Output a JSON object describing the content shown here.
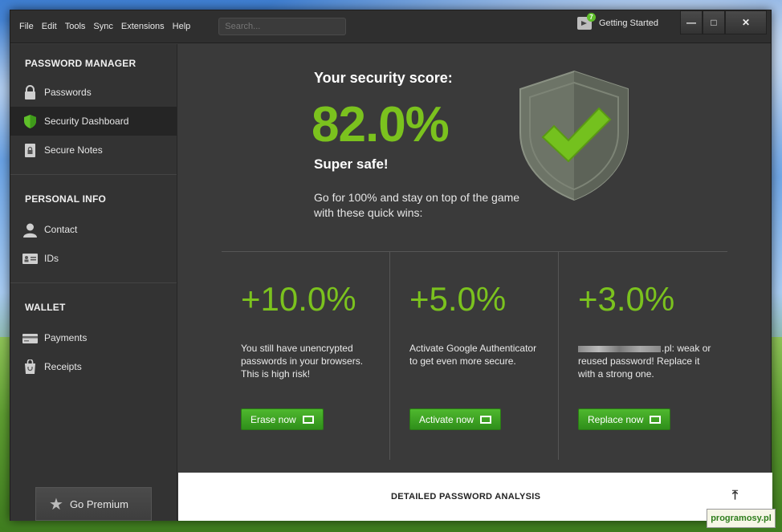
{
  "menu": {
    "items": [
      "File",
      "Edit",
      "Tools",
      "Sync",
      "Extensions",
      "Help"
    ]
  },
  "search": {
    "placeholder": "Search..."
  },
  "header": {
    "getting_started_label": "Getting Started",
    "getting_started_badge": "7"
  },
  "window_controls": {
    "minimize": "—",
    "maximize": "□",
    "close": "✕"
  },
  "sidebar": {
    "sections": [
      {
        "title": "PASSWORD MANAGER",
        "items": [
          {
            "label": "Passwords",
            "icon": "lock-icon"
          },
          {
            "label": "Security Dashboard",
            "icon": "shield-icon",
            "active": true
          },
          {
            "label": "Secure Notes",
            "icon": "note-lock-icon"
          }
        ]
      },
      {
        "title": "PERSONAL INFO",
        "items": [
          {
            "label": "Contact",
            "icon": "person-icon"
          },
          {
            "label": "IDs",
            "icon": "id-card-icon"
          }
        ]
      },
      {
        "title": "WALLET",
        "items": [
          {
            "label": "Payments",
            "icon": "credit-card-icon"
          },
          {
            "label": "Receipts",
            "icon": "receipt-icon"
          }
        ]
      }
    ],
    "premium_label": "Go Premium"
  },
  "score": {
    "title": "Your security score:",
    "value": "82.0%",
    "verdict": "Super safe!",
    "description": "Go for 100% and stay on top of the game with these quick wins:"
  },
  "quick_wins": [
    {
      "percent": "+10.0%",
      "text": "You still have unencrypted passwords in your browsers. This is high risk!",
      "button": "Erase now"
    },
    {
      "percent": "+5.0%",
      "text": "Activate Google Authenticator to get even more secure.",
      "button": "Activate now"
    },
    {
      "percent": "+3.0%",
      "text_suffix": ".pl: weak or reused password! Replace it with a strong one.",
      "button": "Replace now"
    }
  ],
  "analysis": {
    "label": "DETAILED PASSWORD ANALYSIS",
    "icon": "scroll-top-icon"
  },
  "watermark": "programosy.pl",
  "colors": {
    "accent_green": "#7bc21e",
    "button_green": "#3aa024",
    "dark_bg": "#3a3a3a",
    "sidebar_bg": "#333333"
  }
}
